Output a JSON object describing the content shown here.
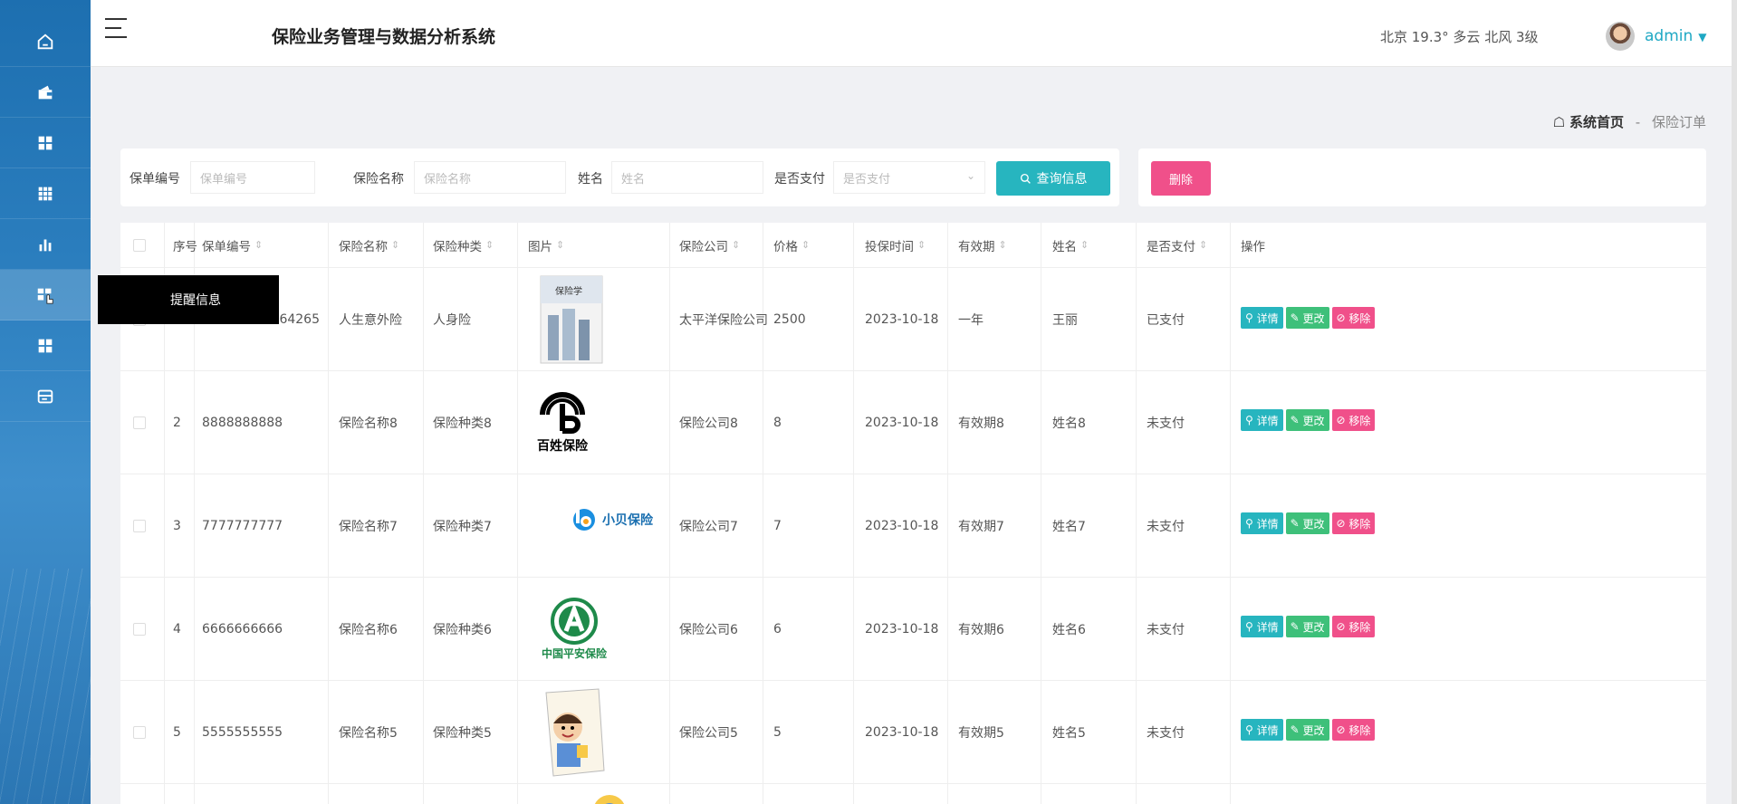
{
  "app": {
    "title": "保险业务管理与数据分析系统"
  },
  "header": {
    "weather": "北京 19.3° 多云 北风 3级",
    "user": "admin",
    "caret": "▼"
  },
  "sidebar": {
    "items": [
      {
        "icon": "home-icon"
      },
      {
        "icon": "wallet-icon"
      },
      {
        "icon": "grid-icon"
      },
      {
        "icon": "table-grid-icon"
      },
      {
        "icon": "bar-chart-icon"
      },
      {
        "icon": "order-grid-icon",
        "active": true
      },
      {
        "icon": "grid-icon"
      },
      {
        "icon": "card-icon"
      }
    ],
    "tooltip": "提醒信息"
  },
  "breadcrumb": {
    "home": "系统首页",
    "separator": "-",
    "current": "保险订单"
  },
  "search": {
    "policy_no_label": "保单编号",
    "policy_no_placeholder": "保单编号",
    "ins_name_label": "保险名称",
    "ins_name_placeholder": "保险名称",
    "name_label": "姓名",
    "name_placeholder": "姓名",
    "paid_label": "是否支付",
    "paid_placeholder": "是否支付",
    "query_button": "查询信息"
  },
  "actions": {
    "delete_button": "删除"
  },
  "table": {
    "headers": [
      "序号",
      "保单编号",
      "保险名称",
      "保险种类",
      "图片",
      "保险公司",
      "价格",
      "投保时间",
      "有效期",
      "姓名",
      "是否支付",
      "操作"
    ],
    "buttons": {
      "detail": "详情",
      "edit": "更改",
      "remove": "移除"
    },
    "rows": [
      {
        "index": "",
        "policy_no": "64265",
        "ins_name": "人生意外险",
        "ins_type": "人身险",
        "image": "book-cover",
        "company": "太平洋保险公司",
        "price": "2500",
        "date": "2023-10-18",
        "validity": "一年",
        "name": "王丽",
        "paid": "已支付"
      },
      {
        "index": "2",
        "policy_no": "8888888888",
        "ins_name": "保险名称8",
        "ins_type": "保险种类8",
        "image": "baixing-logo",
        "image_text": "百姓保险",
        "company": "保险公司8",
        "price": "8",
        "date": "2023-10-18",
        "validity": "有效期8",
        "name": "姓名8",
        "paid": "未支付"
      },
      {
        "index": "3",
        "policy_no": "7777777777",
        "ins_name": "保险名称7",
        "ins_type": "保险种类7",
        "image": "xiaobei-logo",
        "image_text": "小贝保险",
        "company": "保险公司7",
        "price": "7",
        "date": "2023-10-18",
        "validity": "有效期7",
        "name": "姓名7",
        "paid": "未支付"
      },
      {
        "index": "4",
        "policy_no": "6666666666",
        "ins_name": "保险名称6",
        "ins_type": "保险种类6",
        "image": "pingan-logo",
        "image_text": "中国平安保险",
        "company": "保险公司6",
        "price": "6",
        "date": "2023-10-18",
        "validity": "有效期6",
        "name": "姓名6",
        "paid": "未支付"
      },
      {
        "index": "5",
        "policy_no": "5555555555",
        "ins_name": "保险名称5",
        "ins_type": "保险种类5",
        "image": "worker-cartoon",
        "company": "保险公司5",
        "price": "5",
        "date": "2023-10-18",
        "validity": "有效期5",
        "name": "姓名5",
        "paid": "未支付"
      }
    ]
  },
  "colors": {
    "accent": "#27b5bf",
    "edit": "#3ec07a",
    "danger": "#f0508a",
    "sidebar": "#2c7fbf"
  }
}
